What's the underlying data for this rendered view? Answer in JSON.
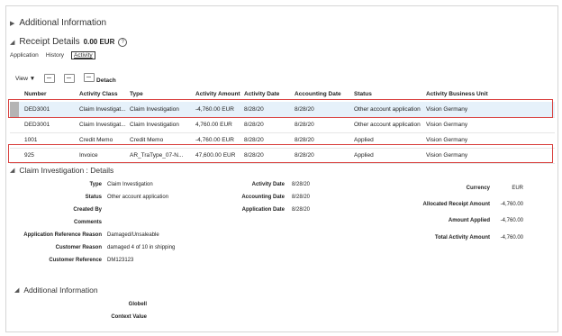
{
  "additional_info_top": {
    "title": "Additional Information"
  },
  "receipt": {
    "title": "Receipt Details",
    "amount": "0.00 EUR",
    "help": "?"
  },
  "tabs": [
    "Application",
    "History",
    "Activity"
  ],
  "toolbar": {
    "view": "View",
    "detach": "Detach"
  },
  "table": {
    "headers": [
      "Number",
      "Activity Class",
      "Type",
      "Activity Amount",
      "Activity Date",
      "Accounting Date",
      "Status",
      "Activity Business Unit"
    ],
    "rows": [
      [
        "DED3001",
        "Claim Investigat...",
        "Claim Investigation",
        "-4,760.00 EUR",
        "8/28/20",
        "8/28/20",
        "Other account application",
        "Vision Germany"
      ],
      [
        "DED3001",
        "Claim Investigat...",
        "Claim Investigation",
        "4,760.00 EUR",
        "8/28/20",
        "8/28/20",
        "Other account application",
        "Vision Germany"
      ],
      [
        "1001",
        "Credit Memo",
        "Credit Memo",
        "-4,760.00 EUR",
        "8/28/20",
        "8/28/20",
        "Applied",
        "Vision Germany"
      ],
      [
        "925",
        "Invoice",
        "AR_TraType_07-N...",
        "47,600.00 EUR",
        "8/28/20",
        "8/28/20",
        "Applied",
        "Vision Germany"
      ]
    ]
  },
  "details": {
    "title": "Claim Investigation : Details",
    "col1": [
      {
        "label": "Type",
        "value": "Claim Investigation"
      },
      {
        "label": "Status",
        "value": "Other account application"
      },
      {
        "label": "Created By",
        "value": ""
      },
      {
        "label": "Comments",
        "value": ""
      },
      {
        "label": "Application Reference Reason",
        "value": "Damaged/Unsaleable"
      },
      {
        "label": "Customer Reason",
        "value": "damaged 4 of 10 in shipping"
      },
      {
        "label": "Customer Reference",
        "value": "DM123123"
      }
    ],
    "col2": [
      {
        "label": "Activity Date",
        "value": "8/28/20"
      },
      {
        "label": "Accounting Date",
        "value": "8/28/20"
      },
      {
        "label": "Application Date",
        "value": "8/28/20"
      }
    ],
    "col3": [
      {
        "label": "Currency",
        "value": "EUR"
      },
      {
        "label": "Allocated Receipt Amount",
        "value": "-4,760.00"
      },
      {
        "label": "Amount Applied",
        "value": "-4,760.00"
      },
      {
        "label": "Total Activity Amount",
        "value": "-4,760.00"
      }
    ]
  },
  "additional_info_bottom": {
    "title": "Additional Information",
    "fields": [
      {
        "label": "Globell",
        "value": ""
      },
      {
        "label": "Context Value",
        "value": ""
      }
    ]
  },
  "colors": {
    "highlight_row": "#e6f1fa",
    "annotation_box": "#d9403e",
    "selected_marker": "#b4b4b4"
  }
}
